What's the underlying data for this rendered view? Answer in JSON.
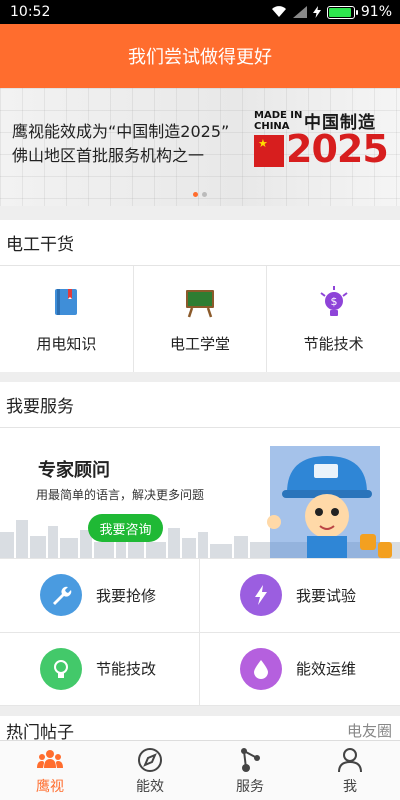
{
  "status_bar": {
    "time": "10:52",
    "battery": "91%",
    "battery_level": 0.91
  },
  "header": {
    "title": "我们尝试做得更好"
  },
  "banner": {
    "line1": "鹰视能效成为“中国制造2025”",
    "line2": "佛山地区首批服务机构之一",
    "logo_made": "MADE IN",
    "logo_china": "CHINA",
    "logo_cn": "中国制造",
    "logo_year": "2025",
    "active_dot": 0
  },
  "section_dgs": {
    "title": "电工干货"
  },
  "dgs_items": [
    {
      "label": "用电知识",
      "icon": "book-icon"
    },
    {
      "label": "电工学堂",
      "icon": "blackboard-icon"
    },
    {
      "label": "节能技术",
      "icon": "lightbulb-dollar-icon"
    }
  ],
  "section_service": {
    "title": "我要服务"
  },
  "promo": {
    "title": "专家顾问",
    "subtitle": "用最简单的语言，解决更多问题",
    "button": "我要咨询"
  },
  "services": [
    {
      "label": "我要抢修",
      "icon": "wrench-icon",
      "color": "#4a9be0"
    },
    {
      "label": "我要试验",
      "icon": "lightning-icon",
      "color": "#9b5ee0"
    },
    {
      "label": "节能技改",
      "icon": "bulb-icon",
      "color": "#43c96a"
    },
    {
      "label": "能效运维",
      "icon": "drop-icon",
      "color": "#b560de"
    }
  ],
  "hot": {
    "title": "热门帖子",
    "right": "电友圈"
  },
  "tabs": [
    {
      "label": "鹰视",
      "icon": "people-icon",
      "active": true
    },
    {
      "label": "能效",
      "icon": "compass-icon",
      "active": false
    },
    {
      "label": "服务",
      "icon": "share-icon",
      "active": false
    },
    {
      "label": "我",
      "icon": "user-icon",
      "active": false
    }
  ],
  "colors": {
    "accent": "#ff6d2e",
    "green": "#1fb935"
  }
}
